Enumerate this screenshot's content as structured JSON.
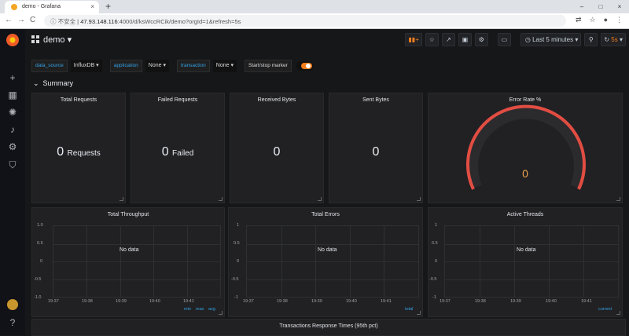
{
  "browser": {
    "tab_title": "demo - Grafana",
    "tab_close": "×",
    "new_tab": "+",
    "url_warning": "不安全",
    "url_host": "47.93.148.116",
    "url_path": ":4000/d/ksWccRCik/demo?orgId=1&refresh=5s",
    "win_min": "–",
    "win_max": "□",
    "win_close": "×",
    "back": "←",
    "forward": "→",
    "reload": "C",
    "info": "ⓘ"
  },
  "dashboard": {
    "title": "demo",
    "time_range": "Last 5 minutes",
    "refresh": "5s"
  },
  "variables": [
    {
      "label": "data_source",
      "value": "InfluxDB ▾"
    },
    {
      "label": "application",
      "value": "None ▾"
    },
    {
      "label": "transaction",
      "value": "None ▾"
    }
  ],
  "marker": {
    "label": "Start/stop marker"
  },
  "row": {
    "title": "Summary"
  },
  "stats": [
    {
      "title": "Total Requests",
      "value": "0",
      "unit": "Requests"
    },
    {
      "title": "Failed Requests",
      "value": "0",
      "unit": "Failed"
    },
    {
      "title": "Received Bytes",
      "value": "0",
      "unit": ""
    },
    {
      "title": "Sent Bytes",
      "value": "0",
      "unit": ""
    }
  ],
  "gauge": {
    "title": "Error Rate %",
    "value": "0",
    "colors": {
      "arc": "#e24d42",
      "track": "#2b2b2e",
      "value": "#f2a34c"
    }
  },
  "graphs": [
    {
      "title": "Total Throughput",
      "yticks": [
        "1.0",
        "0.5",
        "0",
        "-0.5",
        "-1.0"
      ],
      "xticks": [
        "19:37",
        "19:38",
        "19:39",
        "19:40",
        "19:41"
      ],
      "nodata": "No data",
      "legend": [
        "min",
        "max",
        "avg"
      ]
    },
    {
      "title": "Total Errors",
      "yticks": [
        "1",
        "0.5",
        "0",
        "-0.5",
        "-1"
      ],
      "xticks": [
        "19:37",
        "19:38",
        "19:39",
        "19:40",
        "19:41"
      ],
      "nodata": "No data",
      "legend": [
        "total"
      ]
    },
    {
      "title": "Active Threads",
      "yticks": [
        "1",
        "0.5",
        "0",
        "-0.5",
        "-1"
      ],
      "xticks": [
        "19:37",
        "19:38",
        "19:39",
        "19:40",
        "19:41"
      ],
      "nodata": "No data",
      "legend": [
        "current"
      ]
    }
  ],
  "bottom_panel": {
    "title": "Transactions Response Times (95th pct)"
  }
}
